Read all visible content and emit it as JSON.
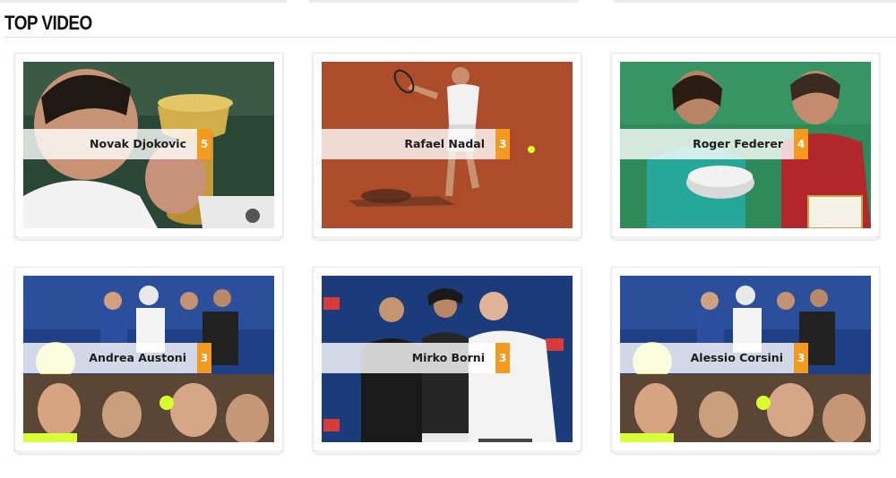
{
  "section": {
    "title": "TOP VIDEO"
  },
  "videos": [
    {
      "name": "Novak Djokovic",
      "count": "5"
    },
    {
      "name": "Rafael Nadal",
      "count": "3"
    },
    {
      "name": "Roger Federer",
      "count": "4"
    },
    {
      "name": "Andrea Austoni",
      "count": "3"
    },
    {
      "name": "Mirko Borni",
      "count": "3"
    },
    {
      "name": "Alessio Corsini",
      "count": "3"
    }
  ],
  "colors": {
    "badge": "#f39a1f",
    "clay": "#b2512e",
    "court_blue": "#1f3f86",
    "green": "#2f8a5a"
  }
}
